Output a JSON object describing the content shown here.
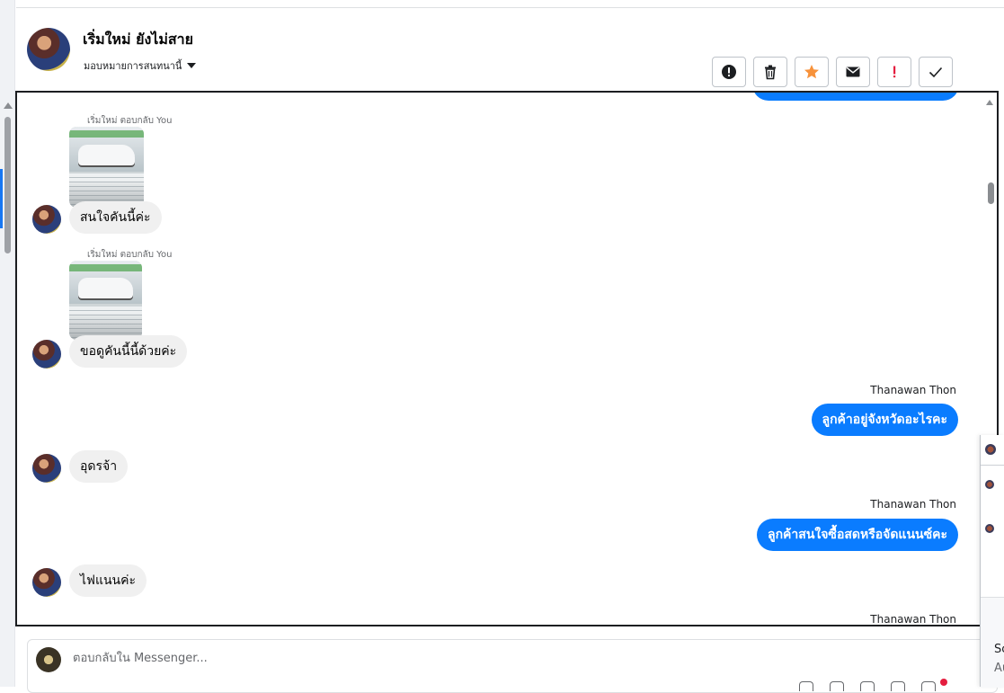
{
  "header": {
    "contact_name": "เริ่มใหม่ ยังไม่สาย",
    "assign_label": "มอบหมายการสนทนานี้"
  },
  "toolbar": {
    "buttons": [
      {
        "name": "report-icon",
        "color": "#1c1e21"
      },
      {
        "name": "trash-icon",
        "color": "#1c1e21"
      },
      {
        "name": "star-icon",
        "color": "#f7923b"
      },
      {
        "name": "mail-icon",
        "color": "#1c1e21"
      },
      {
        "name": "exclamation-icon",
        "color": "#e41e3f"
      },
      {
        "name": "check-icon",
        "color": "#1c1e21"
      }
    ]
  },
  "conversation": {
    "messages": [
      {
        "direction": "in",
        "reply_note": "เริ่มใหม่ ตอบกลับ You",
        "has_image": true,
        "text": "สนใจคันนี้ค่ะ"
      },
      {
        "direction": "in",
        "reply_note": "เริ่มใหม่ ตอบกลับ You",
        "has_image": true,
        "text": "ขอดูคันนี้นี้ด้วยค่ะ"
      },
      {
        "direction": "out",
        "sender": "Thanawan Thon",
        "text": "ลูกค้าอยู่จังหวัดอะไรคะ"
      },
      {
        "direction": "in",
        "text": "อุดรจ้า"
      },
      {
        "direction": "out",
        "sender": "Thanawan Thon",
        "text": "ลูกค้าสนใจซื้อสดหรือจัดแนนซ์คะ"
      },
      {
        "direction": "in",
        "text": "ไฟแนนค่ะ"
      },
      {
        "direction": "out",
        "sender": "Thanawan Thon",
        "text": ""
      }
    ]
  },
  "composer": {
    "placeholder": "ตอบกลับใน Messenger..."
  },
  "side_panel": {
    "line1": "Sc",
    "line2": "Au"
  },
  "colors": {
    "outgoing_bubble": "#0a7cff",
    "incoming_bubble": "#f0f0f0",
    "notification_dot": "#e41e3f"
  }
}
